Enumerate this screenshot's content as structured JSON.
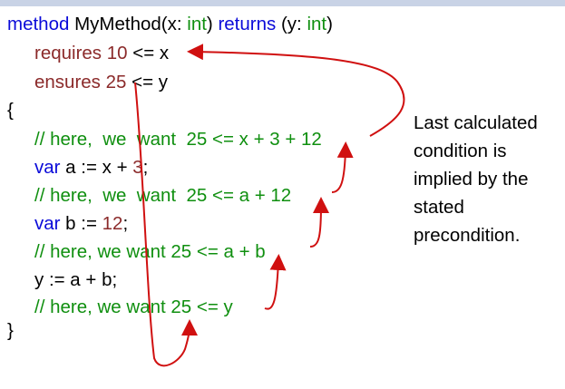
{
  "code": {
    "sig_method": "method",
    "sig_name": "MyMethod(x: ",
    "sig_int1": "int",
    "sig_mid": ") ",
    "sig_returns": "returns",
    "sig_mid2": " (y: ",
    "sig_int2": "int",
    "sig_end": ")",
    "req_kw": "requires",
    "req_num": " 10",
    "req_rest": " <= x",
    "ens_kw": "ensures",
    "ens_num": " 25",
    "ens_rest": " <= y",
    "open_brace": "{",
    "comment1": "// here,  we  want  25 <= x + 3 + 12",
    "var_a_kw": "var",
    "var_a_mid": " a := x + ",
    "var_a_num": "3",
    "var_a_end": ";",
    "comment2": "// here,  we  want  25 <= a + 12",
    "var_b_kw": "var",
    "var_b_mid": " b := ",
    "var_b_num": "12",
    "var_b_end": ";",
    "comment3": "// here, we want 25 <= a + b",
    "assign_y": "y := a + b;",
    "comment4": "// here, we want 25 <= y",
    "close_brace": "}"
  },
  "note": "Last calculated condition is implied by the stated precondition.",
  "colors": {
    "keyword": "#0b0bd9",
    "type": "#0f8f0f",
    "comment": "#0f8f0f",
    "accent": "#8b2a2a",
    "arrow": "#d01010"
  }
}
